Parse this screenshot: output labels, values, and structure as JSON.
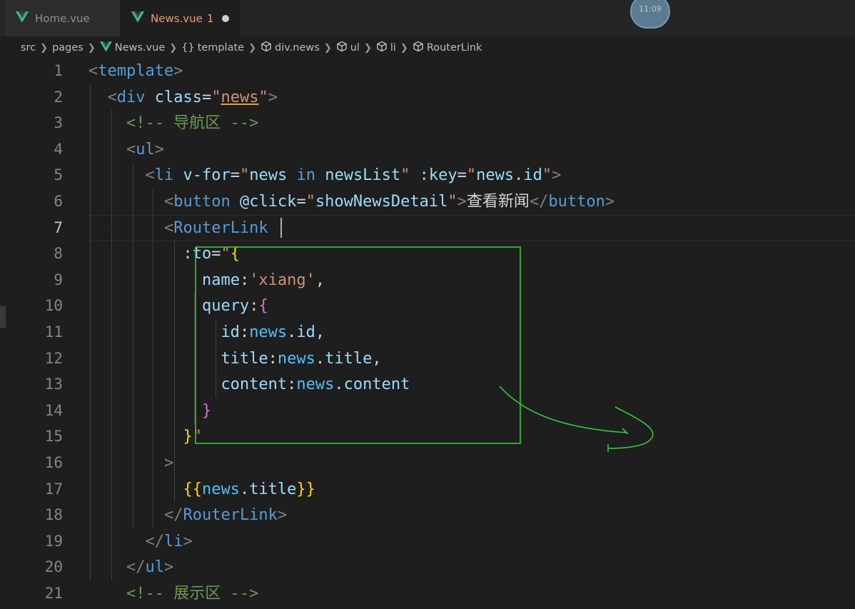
{
  "tabs": [
    {
      "label": "Home.vue"
    },
    {
      "label": "News.vue",
      "problems": "1"
    }
  ],
  "clock": "11:09",
  "breadcrumb": [
    "src",
    "pages",
    "News.vue",
    "template",
    "div.news",
    "ul",
    "li",
    "RouterLink"
  ],
  "editor": {
    "active_line": 7,
    "lines": [
      {
        "n": "1",
        "tokens": [
          [
            "t-tag",
            "<"
          ],
          [
            "t-name",
            "template"
          ],
          [
            "t-tag",
            ">"
          ]
        ]
      },
      {
        "n": "2",
        "tokens": [
          [
            "t-txt",
            "  "
          ],
          [
            "t-tag",
            "<"
          ],
          [
            "t-name",
            "div"
          ],
          [
            "t-txt",
            " "
          ],
          [
            "t-attr",
            "class"
          ],
          [
            "t-txt",
            "="
          ],
          [
            "t-str",
            "\""
          ],
          [
            "t-str u-line",
            "news"
          ],
          [
            "t-str",
            "\""
          ],
          [
            "t-tag",
            ">"
          ]
        ]
      },
      {
        "n": "3",
        "tokens": [
          [
            "t-txt",
            "    "
          ],
          [
            "t-com",
            "<!-- 导航区 -->"
          ]
        ]
      },
      {
        "n": "4",
        "tokens": [
          [
            "t-txt",
            "    "
          ],
          [
            "t-tag",
            "<"
          ],
          [
            "t-name",
            "ul"
          ],
          [
            "t-tag",
            ">"
          ]
        ]
      },
      {
        "n": "5",
        "tokens": [
          [
            "t-txt",
            "      "
          ],
          [
            "t-tag",
            "<"
          ],
          [
            "t-name",
            "li"
          ],
          [
            "t-txt",
            " "
          ],
          [
            "t-attr",
            "v-for"
          ],
          [
            "t-txt",
            "="
          ],
          [
            "t-str",
            "\""
          ],
          [
            "t-prop",
            "news"
          ],
          [
            "t-txt",
            " "
          ],
          [
            "t-name",
            "in"
          ],
          [
            "t-txt",
            " "
          ],
          [
            "t-prop",
            "newsList"
          ],
          [
            "t-str",
            "\""
          ],
          [
            "t-txt",
            " "
          ],
          [
            "t-attr",
            ":key"
          ],
          [
            "t-txt",
            "="
          ],
          [
            "t-str",
            "\""
          ],
          [
            "t-prop",
            "news"
          ],
          [
            "t-txt",
            "."
          ],
          [
            "t-prop",
            "id"
          ],
          [
            "t-str",
            "\""
          ],
          [
            "t-tag",
            ">"
          ]
        ]
      },
      {
        "n": "6",
        "tokens": [
          [
            "t-txt",
            "        "
          ],
          [
            "t-tag",
            "<"
          ],
          [
            "t-name",
            "button"
          ],
          [
            "t-txt",
            " "
          ],
          [
            "t-attr",
            "@click"
          ],
          [
            "t-txt",
            "="
          ],
          [
            "t-str",
            "\""
          ],
          [
            "t-prop",
            "showNewsDetail"
          ],
          [
            "t-str",
            "\""
          ],
          [
            "t-tag",
            ">"
          ],
          [
            "t-txt",
            "查看新闻"
          ],
          [
            "t-tag",
            "</"
          ],
          [
            "t-name",
            "button"
          ],
          [
            "t-tag",
            ">"
          ]
        ]
      },
      {
        "n": "7",
        "tokens": [
          [
            "t-txt",
            "        "
          ],
          [
            "t-tag",
            "<"
          ],
          [
            "t-name",
            "RouterLink"
          ],
          [
            "t-txt",
            " "
          ]
        ]
      },
      {
        "n": "8",
        "tokens": [
          [
            "t-txt",
            "          "
          ],
          [
            "t-attr",
            ":to"
          ],
          [
            "t-txt",
            "="
          ],
          [
            "t-str",
            "\""
          ],
          [
            "t-br1",
            "{"
          ]
        ]
      },
      {
        "n": "9",
        "tokens": [
          [
            "t-txt",
            "            "
          ],
          [
            "t-prop",
            "name"
          ],
          [
            "t-txt",
            ":"
          ],
          [
            "t-str",
            "'xiang'"
          ],
          [
            "t-txt",
            ","
          ]
        ]
      },
      {
        "n": "10",
        "tokens": [
          [
            "t-txt",
            "            "
          ],
          [
            "t-prop",
            "query"
          ],
          [
            "t-txt",
            ":"
          ],
          [
            "t-br2",
            "{"
          ]
        ]
      },
      {
        "n": "11",
        "tokens": [
          [
            "t-txt",
            "              "
          ],
          [
            "t-prop",
            "id"
          ],
          [
            "t-txt",
            ":"
          ],
          [
            "t-var",
            "news"
          ],
          [
            "t-txt",
            "."
          ],
          [
            "t-prop",
            "id"
          ],
          [
            "t-txt",
            ","
          ]
        ]
      },
      {
        "n": "12",
        "tokens": [
          [
            "t-txt",
            "              "
          ],
          [
            "t-prop",
            "title"
          ],
          [
            "t-txt",
            ":"
          ],
          [
            "t-var",
            "news"
          ],
          [
            "t-txt",
            "."
          ],
          [
            "t-prop",
            "title"
          ],
          [
            "t-txt",
            ","
          ]
        ]
      },
      {
        "n": "13",
        "tokens": [
          [
            "t-txt",
            "              "
          ],
          [
            "t-prop",
            "content"
          ],
          [
            "t-txt",
            ":"
          ],
          [
            "t-var",
            "news"
          ],
          [
            "t-txt",
            "."
          ],
          [
            "t-prop",
            "content"
          ]
        ]
      },
      {
        "n": "14",
        "tokens": [
          [
            "t-txt",
            "            "
          ],
          [
            "t-br2",
            "}"
          ]
        ]
      },
      {
        "n": "15",
        "tokens": [
          [
            "t-txt",
            "          "
          ],
          [
            "t-br1",
            "}"
          ],
          [
            "t-str",
            "\""
          ]
        ]
      },
      {
        "n": "16",
        "tokens": [
          [
            "t-txt",
            "        "
          ],
          [
            "t-tag",
            ">"
          ]
        ]
      },
      {
        "n": "17",
        "tokens": [
          [
            "t-txt",
            "          "
          ],
          [
            "t-br1",
            "{{"
          ],
          [
            "t-var",
            "news"
          ],
          [
            "t-txt",
            "."
          ],
          [
            "t-prop",
            "title"
          ],
          [
            "t-br1",
            "}}"
          ]
        ]
      },
      {
        "n": "18",
        "tokens": [
          [
            "t-txt",
            "        "
          ],
          [
            "t-tag",
            "</"
          ],
          [
            "t-name",
            "RouterLink"
          ],
          [
            "t-tag",
            ">"
          ]
        ]
      },
      {
        "n": "19",
        "tokens": [
          [
            "t-txt",
            "      "
          ],
          [
            "t-tag",
            "</"
          ],
          [
            "t-name",
            "li"
          ],
          [
            "t-tag",
            ">"
          ]
        ]
      },
      {
        "n": "20",
        "tokens": [
          [
            "t-txt",
            "    "
          ],
          [
            "t-tag",
            "</"
          ],
          [
            "t-name",
            "ul"
          ],
          [
            "t-tag",
            ">"
          ]
        ]
      },
      {
        "n": "21",
        "tokens": [
          [
            "t-txt",
            "    "
          ],
          [
            "t-com",
            "<!-- 展示区 -->"
          ]
        ]
      }
    ]
  },
  "colors": {
    "annotation": "#33cc33",
    "vue_logo_outer": "#41b883",
    "vue_logo_inner": "#35495e"
  }
}
